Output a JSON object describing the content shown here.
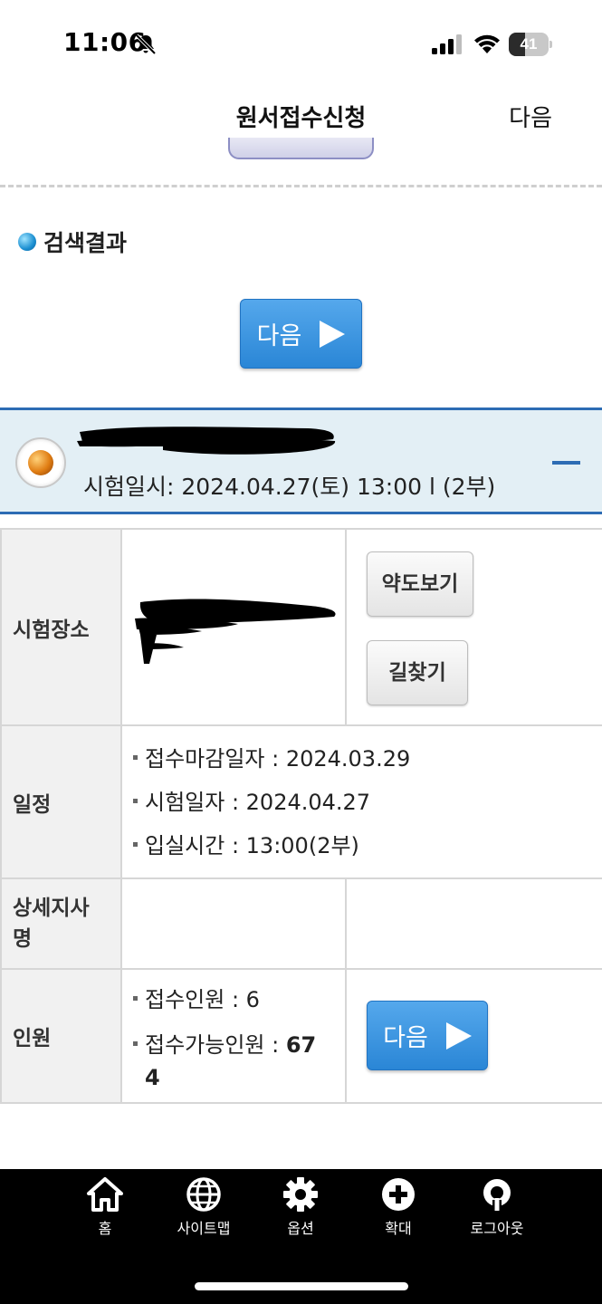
{
  "status_bar": {
    "time": "11:06",
    "battery": "41",
    "battery_level": 0.41,
    "icons": [
      "bell-slash-icon",
      "cellular-signal-icon",
      "wifi-icon",
      "battery-icon"
    ]
  },
  "nav": {
    "title": "원서접수신청",
    "next_label": "다음"
  },
  "search": {
    "heading": "검색결과",
    "next_button_label": "다음"
  },
  "exam": {
    "datetime": "시험일시: 2024.04.27(토) 13:00 l  (2부)",
    "name_redacted": true
  },
  "table": {
    "venue_header": "시험장소",
    "map_button": "약도보기",
    "directions_button": "길찾기",
    "schedule_header": "일정",
    "schedule_items": [
      "접수마감일자 : 2024.03.29",
      "시험일자 : 2024.04.27",
      "입실시간 : 13:00(2부)"
    ],
    "detail_header": "상세지사명",
    "headcount_header": "인원",
    "applied_label": "접수인원 : 6",
    "available_label": "접수가능인원 : ",
    "available_value": "674",
    "next_button_label": "다음"
  },
  "bottom_nav": {
    "items": [
      {
        "label": "홈",
        "icon": "home-icon"
      },
      {
        "label": "사이트맵",
        "icon": "globe-icon"
      },
      {
        "label": "옵션",
        "icon": "gear-icon"
      },
      {
        "label": "확대",
        "icon": "plus-circle-icon"
      },
      {
        "label": "로그아웃",
        "icon": "logout-icon"
      }
    ]
  },
  "colors": {
    "accent_blue": "#2a86d6",
    "exam_bar_bg": "#e3eff5",
    "exam_bar_border": "#2d6cb4",
    "bottom_bar": "#000000"
  }
}
